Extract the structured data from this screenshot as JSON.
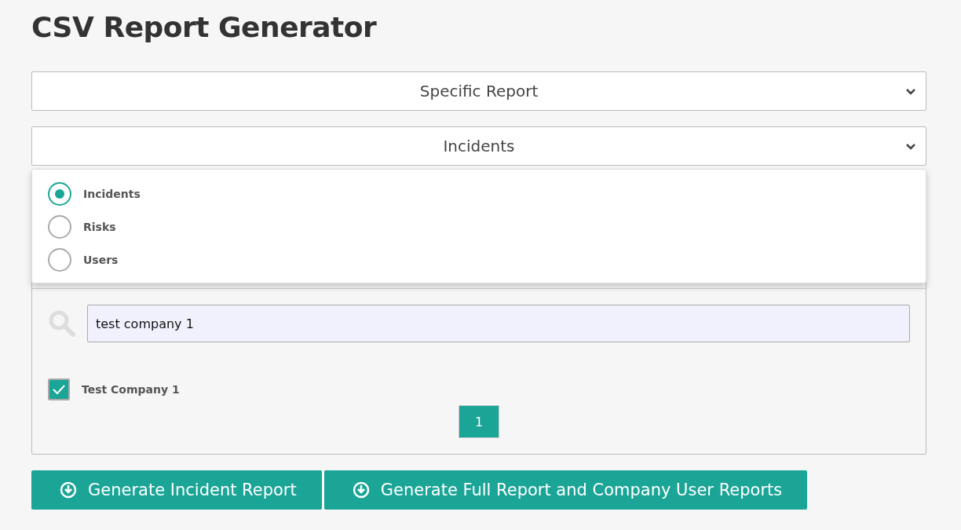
{
  "title": "CSV Report Generator",
  "selects": [
    {
      "value": "Specific Report"
    },
    {
      "value": "Incidents",
      "options": [
        {
          "label": "Incidents",
          "selected": true
        },
        {
          "label": "Risks",
          "selected": false
        },
        {
          "label": "Users",
          "selected": false
        }
      ]
    }
  ],
  "search": {
    "value": "test company 1"
  },
  "companies": [
    {
      "label": "Test Company 1",
      "checked": true
    }
  ],
  "pages": [
    {
      "label": "1",
      "selected": true
    }
  ],
  "buttons": [
    "Generate Incident Report",
    "Generate Full Report and Company User Reports"
  ]
}
